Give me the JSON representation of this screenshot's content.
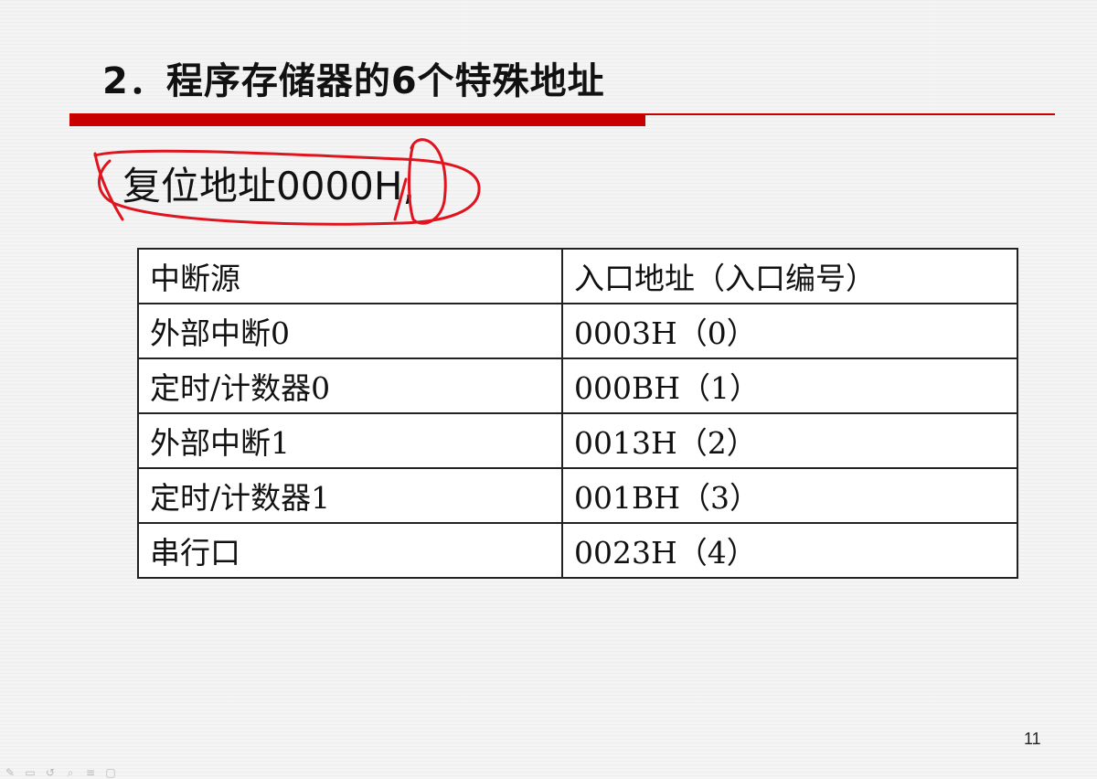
{
  "slide": {
    "title": "2．程序存储器的6个特殊地址",
    "reset_text": "复位地址0000H,",
    "page_number": "11"
  },
  "table": {
    "headers": [
      "中断源",
      "入口地址（入口编号）"
    ],
    "rows": [
      [
        "外部中断0",
        "0003H（0）"
      ],
      [
        "定时/计数器0",
        "000BH（1）"
      ],
      [
        "外部中断1",
        "0013H（2）"
      ],
      [
        "定时/计数器1",
        "001BH（3）"
      ],
      [
        "串行口",
        "0023H（4）"
      ]
    ]
  },
  "colors": {
    "accent_rule": "#c80000",
    "annotation_ink": "#e0141e"
  },
  "toolbar": {
    "icons": [
      "pen-icon",
      "eraser-icon",
      "undo-icon",
      "zoom-icon",
      "menu-icon",
      "screen-icon"
    ]
  }
}
